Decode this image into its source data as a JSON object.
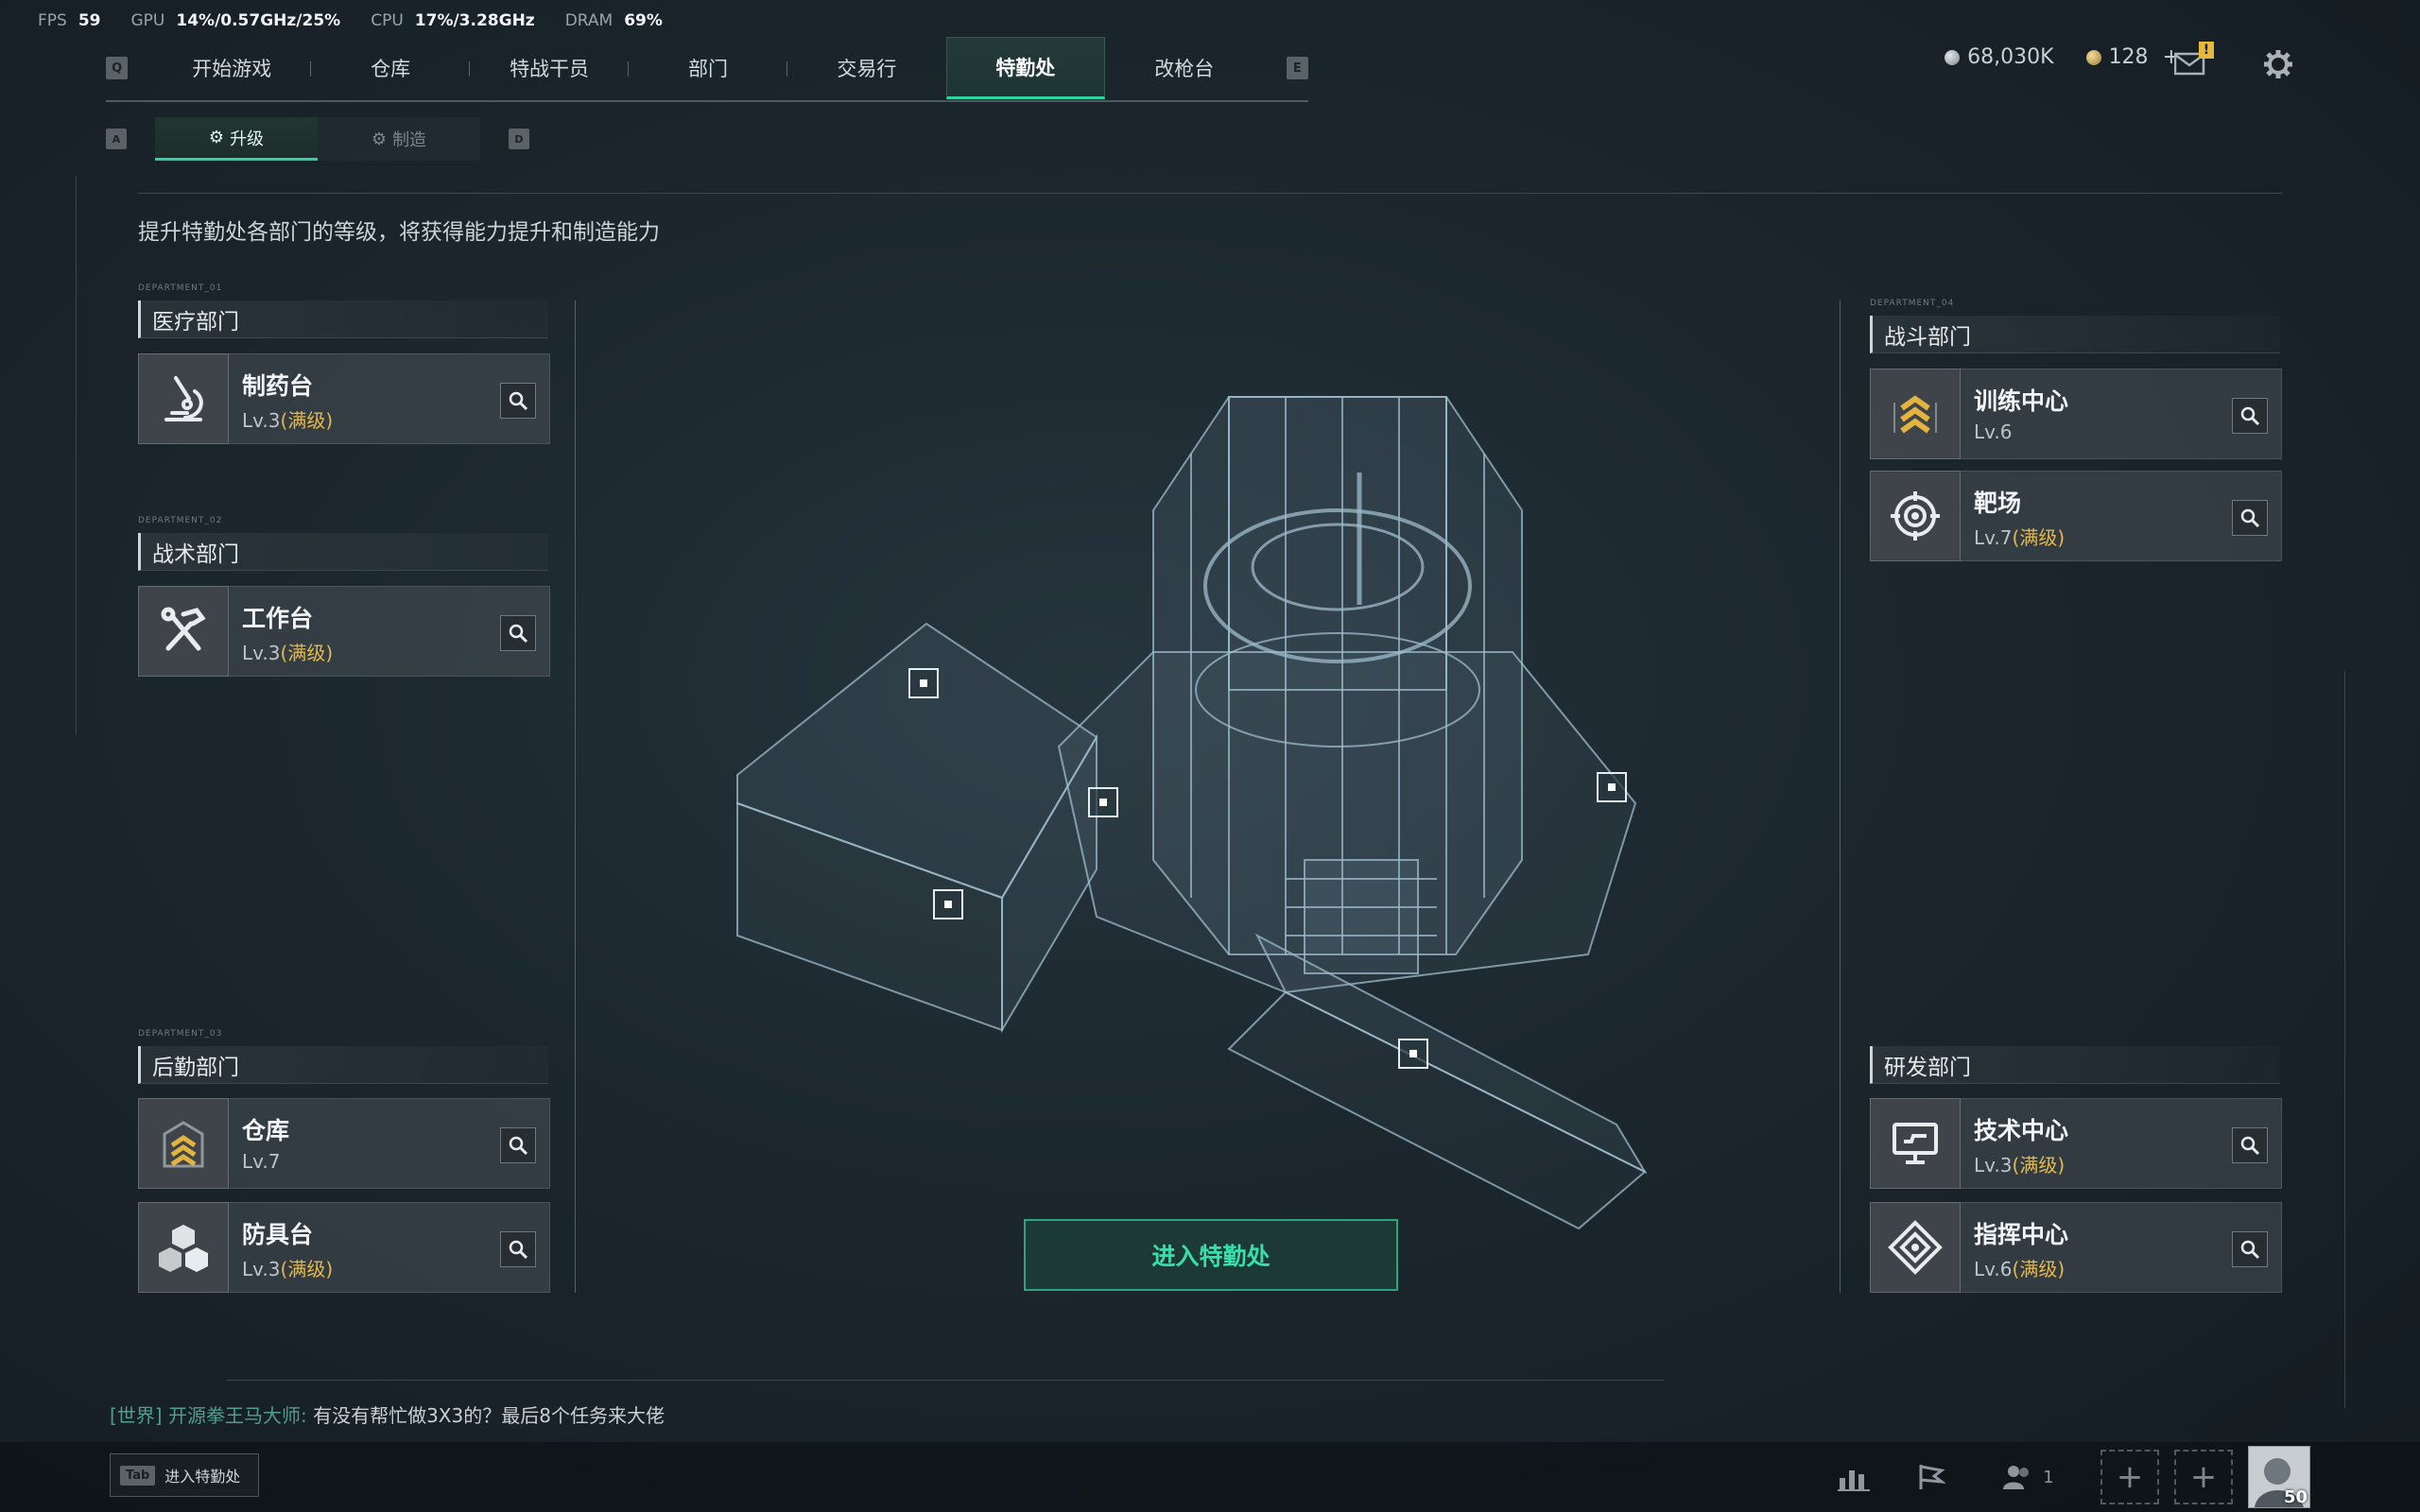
{
  "perf": {
    "fps_label": "FPS",
    "fps": "59",
    "gpu_label": "GPU",
    "gpu": "14%/0.57GHz/25%",
    "cpu_label": "CPU",
    "cpu": "17%/3.28GHz",
    "dram_label": "DRAM",
    "dram": "69%"
  },
  "topnav": {
    "left_key": "Q",
    "right_key": "E",
    "tabs": [
      "开始游戏",
      "仓库",
      "特战干员",
      "部门",
      "交易行",
      "特勤处",
      "改枪台"
    ],
    "active_index": 5
  },
  "currency": {
    "coins": "68,030K",
    "bonds": "128",
    "plus": "+"
  },
  "notification_badge": "!",
  "subtabs": {
    "left_key": "A",
    "right_key": "D",
    "upgrade": "升级",
    "craft": "制造"
  },
  "description": "提升特勤处各部门的等级，将获得能力提升和制造能力",
  "departments": {
    "medical": {
      "tag": "DEPARTMENT_01",
      "title": "医疗部门",
      "cards": [
        {
          "name": "制药台",
          "level": "Lv.3",
          "maxed": "(满级)",
          "icon": "microscope-icon"
        }
      ]
    },
    "tactical": {
      "tag": "DEPARTMENT_02",
      "title": "战术部门",
      "cards": [
        {
          "name": "工作台",
          "level": "Lv.3",
          "maxed": "(满级)",
          "icon": "tools-icon"
        }
      ]
    },
    "logistics": {
      "tag": "DEPARTMENT_03",
      "title": "后勤部门",
      "cards": [
        {
          "name": "仓库",
          "level": "Lv.7",
          "maxed": "",
          "icon": "warehouse-chevron-icon"
        },
        {
          "name": "防具台",
          "level": "Lv.3",
          "maxed": "(满级)",
          "icon": "cubes-icon"
        }
      ]
    },
    "combat": {
      "tag": "DEPARTMENT_04",
      "title": "战斗部门",
      "cards": [
        {
          "name": "训练中心",
          "level": "Lv.6",
          "maxed": "",
          "icon": "rank-chevron-icon"
        },
        {
          "name": "靶场",
          "level": "Lv.7",
          "maxed": "(满级)",
          "icon": "target-icon"
        }
      ]
    },
    "research": {
      "title": "研发部门",
      "cards": [
        {
          "name": "技术中心",
          "level": "Lv.3",
          "maxed": "(满级)",
          "icon": "monitor-icon"
        },
        {
          "name": "指挥中心",
          "level": "Lv.6",
          "maxed": "(满级)",
          "icon": "diamond-emblem-icon"
        }
      ]
    }
  },
  "enter_button": "进入特勤处",
  "chat": {
    "channel": "[世界]",
    "user": "开源拳王马大师:",
    "message": "有没有帮忙做3X3的？最后8个任务来大佬"
  },
  "tab_hint": {
    "key": "Tab",
    "label": "进入特勤处"
  },
  "bottom": {
    "squad_count": "1",
    "avatar_level": "50"
  },
  "colors": {
    "accent": "#2fd3a1",
    "maxed": "#e3b94e",
    "channel": "#4f9e90"
  }
}
